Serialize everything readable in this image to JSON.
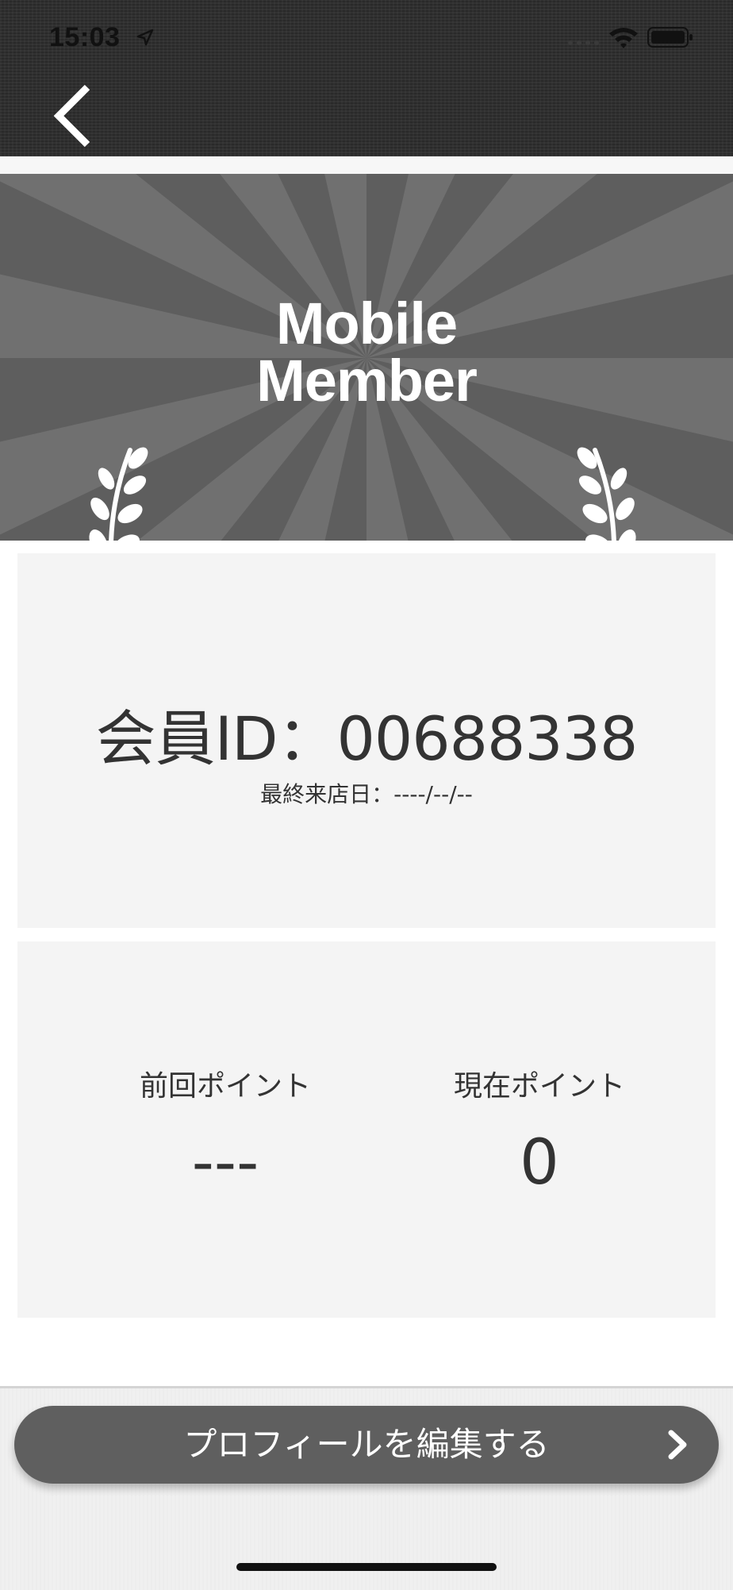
{
  "status_bar": {
    "time": "15:03"
  },
  "nav": {
    "back_icon": "chevron-left-icon"
  },
  "banner": {
    "title_line1": "Mobile",
    "title_line2": "Member",
    "decoration": "laurel-icon"
  },
  "member": {
    "id_text": "会員ID：00688338",
    "last_visit": "最終来店日：----/--/--"
  },
  "points": {
    "previous_label": "前回ポイント",
    "previous_value": "---",
    "current_label": "現在ポイント",
    "current_value": "0"
  },
  "actions": {
    "edit_profile_label": "プロフィールを編集する",
    "edit_profile_icon": "chevron-right-icon"
  },
  "colors": {
    "topbar": "#2c2c2c",
    "banner": "#5e5e5e",
    "card": "#f4f4f4",
    "button": "#5f5f5f",
    "text": "#333333"
  }
}
